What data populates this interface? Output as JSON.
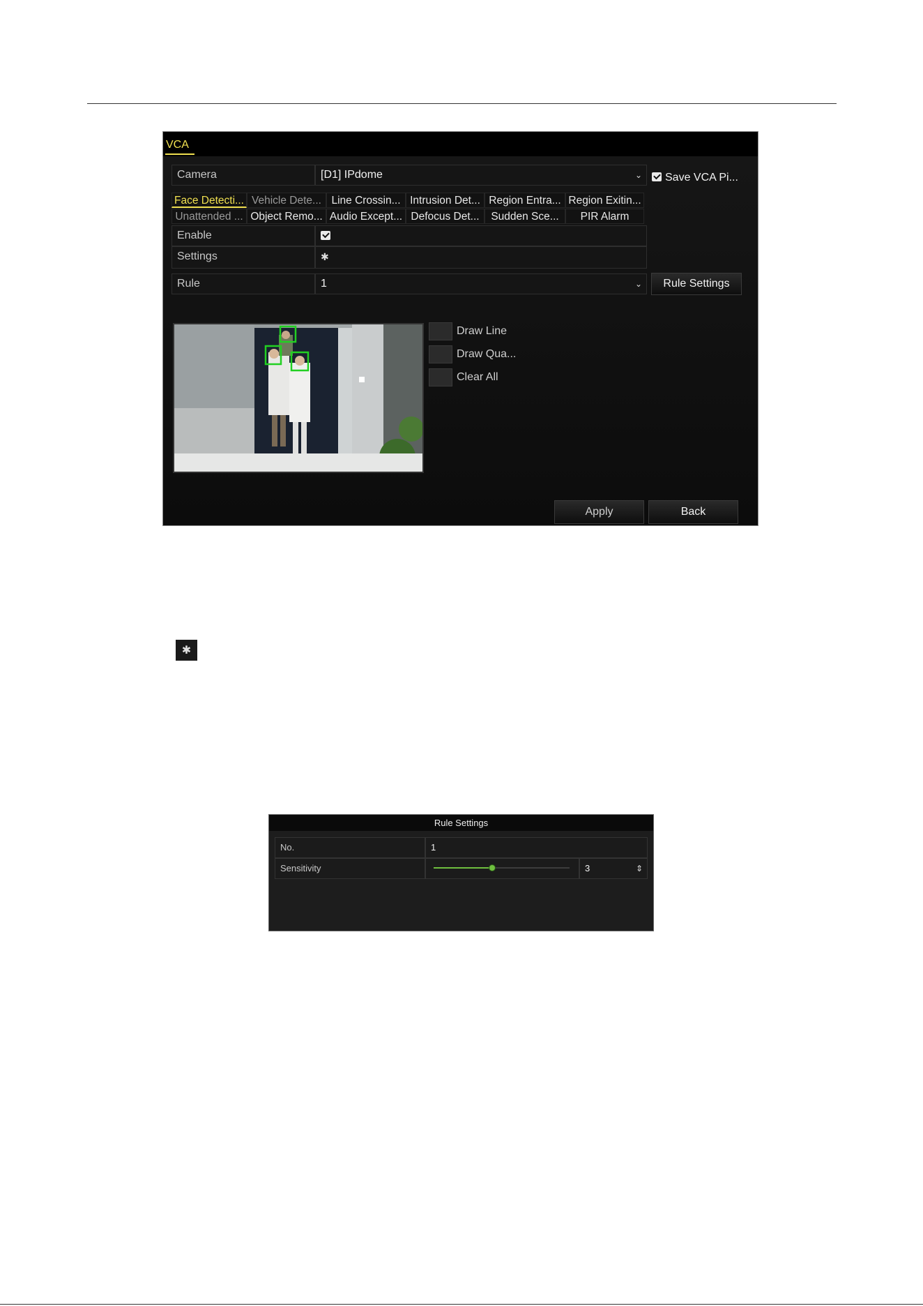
{
  "vca_window": {
    "tab": "VCA",
    "camera": {
      "label": "Camera",
      "value": "[D1] IPdome"
    },
    "save_vca_picture": {
      "label": "Save VCA Pi...",
      "checked": true
    },
    "function_tabs_row1": [
      "Face Detecti...",
      "Vehicle Dete...",
      "Line Crossin...",
      "Intrusion Det...",
      "Region Entra...",
      "Region Exitin..."
    ],
    "function_tabs_row2": [
      "Unattended ...",
      "Object Remo...",
      "Audio Except...",
      "Defocus Det...",
      "Sudden Sce...",
      "PIR Alarm"
    ],
    "active_tab": "Face Detecti...",
    "enable": {
      "label": "Enable",
      "checked": true
    },
    "settings": {
      "label": "Settings",
      "icon": "gear-icon"
    },
    "rule": {
      "label": "Rule",
      "value": "1"
    },
    "rule_settings_button": "Rule Settings",
    "tools": [
      {
        "label": "Draw Line",
        "icon": "draw-line-icon"
      },
      {
        "label": "Draw Qua...",
        "icon": "draw-quadrilateral-icon"
      },
      {
        "label": "Clear All",
        "icon": "clear-all-icon"
      }
    ],
    "apply_button": "Apply",
    "back_button": "Back",
    "accent_color": "#f0e050",
    "detection_box_color": "#22d022"
  },
  "rule_settings_dialog": {
    "title": "Rule Settings",
    "no": {
      "label": "No.",
      "value": "1"
    },
    "sensitivity": {
      "label": "Sensitivity",
      "value": "3",
      "slider_level": 0.43
    },
    "slider_color": "#6fbf3f"
  }
}
